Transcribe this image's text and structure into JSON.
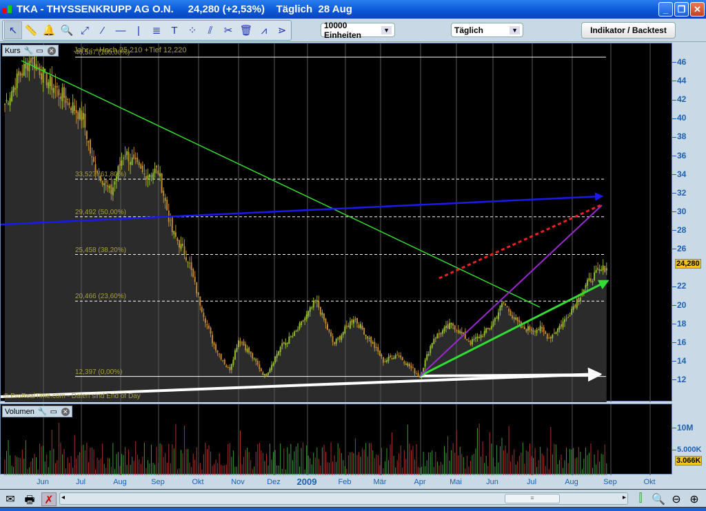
{
  "window": {
    "title": "TKA - THYSSENKRUPP AG O.N.     24,280 (+2,53%)    Täglich  28 Aug",
    "buttons": {
      "minimize": "_",
      "restore": "❐",
      "close": "✕"
    }
  },
  "toolbar": {
    "tools": [
      {
        "name": "pointer",
        "glyph": "↖"
      },
      {
        "name": "ruler",
        "glyph": "📏"
      },
      {
        "name": "alarm-bell",
        "glyph": "🔔"
      },
      {
        "name": "zoom",
        "glyph": "🔍"
      },
      {
        "name": "segment",
        "glyph": "⤢"
      },
      {
        "name": "line",
        "glyph": "⁄"
      },
      {
        "name": "horizontal-line",
        "glyph": "—"
      },
      {
        "name": "vertical-line",
        "glyph": "|"
      },
      {
        "name": "fibonacci",
        "glyph": "≣"
      },
      {
        "name": "text",
        "glyph": "T"
      },
      {
        "name": "points",
        "glyph": "⁘"
      },
      {
        "name": "parallel",
        "glyph": "⫽"
      },
      {
        "name": "properties-tools",
        "glyph": "✂"
      },
      {
        "name": "trash",
        "glyph": "🗑"
      },
      {
        "name": "channel",
        "glyph": "⩘"
      },
      {
        "name": "triangle-channel",
        "glyph": "⋗"
      }
    ],
    "units_select": "10000 Einheiten",
    "period_select": "Täglich",
    "indicator_button": "Indikator / Backtest"
  },
  "price_panel": {
    "label": "Kurs",
    "range_info": "Jahr : +Hoch 25,210 +Tief 12,220",
    "copyright": "© ProRealTime.com - Daten sind End of Day",
    "fib_levels": [
      {
        "label": "46,587 (100,00%)",
        "price": 46.587,
        "style": "solid"
      },
      {
        "label": "33,527 (61,80%)",
        "price": 33.527,
        "style": "dashed"
      },
      {
        "label": "29,492 (50,00%)",
        "price": 29.492,
        "style": "dashed"
      },
      {
        "label": "25,458 (38,20%)",
        "price": 25.458,
        "style": "dashed"
      },
      {
        "label": "20,466 (23,60%)",
        "price": 20.466,
        "style": "dashed"
      },
      {
        "label": "12,397 (0,00%)",
        "price": 12.397,
        "style": "solid"
      }
    ],
    "axis_ticks": [
      "46",
      "44",
      "42",
      "40",
      "38",
      "36",
      "34",
      "32",
      "30",
      "28",
      "26",
      "22",
      "20",
      "18",
      "16",
      "14",
      "12"
    ],
    "last_price": "24,280"
  },
  "volume_panel": {
    "label": "Volumen",
    "axis_ticks": [
      "10M",
      "5.000K"
    ],
    "last_volume": "3.066K"
  },
  "date_axis": [
    "Jun",
    "Jul",
    "Aug",
    "Sep",
    "Okt",
    "Nov",
    "Dez",
    "2009",
    "Feb",
    "Mär",
    "Apr",
    "Mai",
    "Jun",
    "Jul",
    "Aug",
    "Sep",
    "Okt"
  ],
  "colors": {
    "candle_up": "#8fb82e",
    "candle_down": "#c08a30",
    "vol_up": "#3a9a3a",
    "vol_down": "#b03030",
    "badge": "#f3c21c",
    "axis_text": "#1d5fb0"
  },
  "chart_data": {
    "type": "candlestick",
    "ylim": [
      11,
      47.5
    ],
    "close_anchors": [
      [
        "2008-05-01",
        41.5
      ],
      [
        "2008-05-10",
        44
      ],
      [
        "2008-05-22",
        46.5
      ],
      [
        "2008-06-05",
        44
      ],
      [
        "2008-06-20",
        42
      ],
      [
        "2008-07-03",
        40
      ],
      [
        "2008-07-10",
        35.5
      ],
      [
        "2008-07-25",
        32
      ],
      [
        "2008-08-05",
        36.5
      ],
      [
        "2008-08-20",
        34
      ],
      [
        "2008-09-01",
        34.5
      ],
      [
        "2008-09-12",
        28
      ],
      [
        "2008-09-25",
        25
      ],
      [
        "2008-10-03",
        21
      ],
      [
        "2008-10-15",
        16
      ],
      [
        "2008-10-28",
        13
      ],
      [
        "2008-11-05",
        16.5
      ],
      [
        "2008-11-18",
        14
      ],
      [
        "2008-11-26",
        12.4
      ],
      [
        "2008-12-08",
        15.5
      ],
      [
        "2008-12-20",
        17
      ],
      [
        "2009-01-06",
        20.5
      ],
      [
        "2009-01-20",
        15.8
      ],
      [
        "2009-02-05",
        18.7
      ],
      [
        "2009-02-20",
        16
      ],
      [
        "2009-03-01",
        14
      ],
      [
        "2009-03-12",
        14.8
      ],
      [
        "2009-03-30",
        12.4
      ],
      [
        "2009-04-10",
        16.5
      ],
      [
        "2009-04-25",
        18
      ],
      [
        "2009-05-10",
        16
      ],
      [
        "2009-05-25",
        17.5
      ],
      [
        "2009-06-05",
        20.3
      ],
      [
        "2009-06-20",
        17.5
      ],
      [
        "2009-07-05",
        17.5
      ],
      [
        "2009-07-12",
        16.5
      ],
      [
        "2009-07-25",
        18.5
      ],
      [
        "2009-08-05",
        21
      ],
      [
        "2009-08-15",
        23
      ],
      [
        "2009-08-28",
        24.28
      ]
    ]
  }
}
